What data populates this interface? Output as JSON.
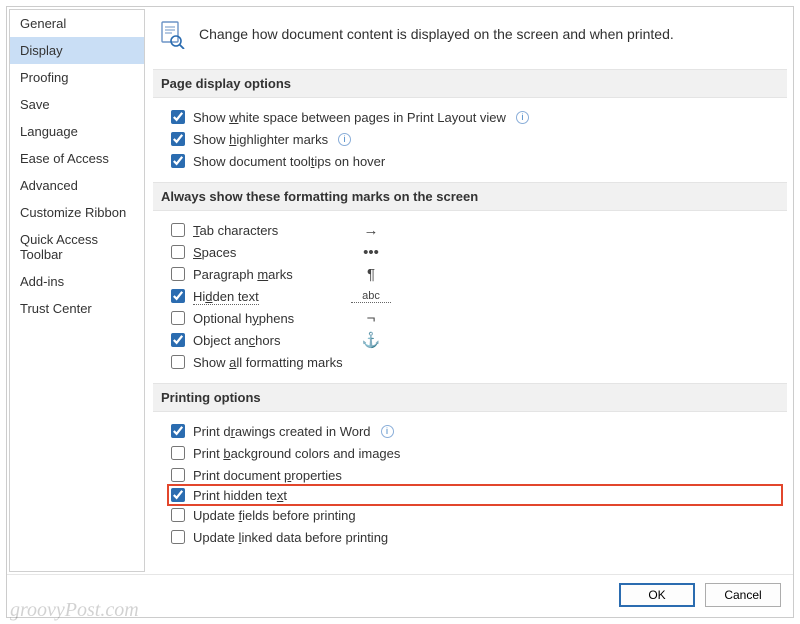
{
  "header": {
    "text": "Change how document content is displayed on the screen and when printed."
  },
  "sidebar": {
    "items": [
      {
        "label": "General",
        "selected": false,
        "name": "sidebar-item-general"
      },
      {
        "label": "Display",
        "selected": true,
        "name": "sidebar-item-display"
      },
      {
        "label": "Proofing",
        "selected": false,
        "name": "sidebar-item-proofing"
      },
      {
        "label": "Save",
        "selected": false,
        "name": "sidebar-item-save"
      },
      {
        "label": "Language",
        "selected": false,
        "name": "sidebar-item-language"
      },
      {
        "label": "Ease of Access",
        "selected": false,
        "name": "sidebar-item-ease-of-access"
      },
      {
        "label": "Advanced",
        "selected": false,
        "name": "sidebar-item-advanced"
      },
      {
        "label": "Customize Ribbon",
        "selected": false,
        "name": "sidebar-item-customize-ribbon"
      },
      {
        "label": "Quick Access Toolbar",
        "selected": false,
        "name": "sidebar-item-quick-access-toolbar"
      },
      {
        "label": "Add-ins",
        "selected": false,
        "name": "sidebar-item-add-ins"
      },
      {
        "label": "Trust Center",
        "selected": false,
        "name": "sidebar-item-trust-center"
      }
    ]
  },
  "sections": {
    "page_display": {
      "title": "Page display options",
      "items": [
        {
          "label_pre": "Show ",
          "accel": "w",
          "label_post": "hite space between pages in Print Layout view",
          "checked": true,
          "info": true,
          "name": "opt-white-space"
        },
        {
          "label_pre": "Show ",
          "accel": "h",
          "label_post": "ighlighter marks",
          "checked": true,
          "info": true,
          "name": "opt-highlighter"
        },
        {
          "label_pre": "Show document tool",
          "accel": "t",
          "label_post": "ips on hover",
          "checked": true,
          "info": false,
          "name": "opt-tooltips"
        }
      ]
    },
    "formatting_marks": {
      "title": "Always show these formatting marks on the screen",
      "items": [
        {
          "accel": "T",
          "label_rest": "ab characters",
          "checked": false,
          "symbol": "→",
          "symclass": "",
          "name": "opt-tab-chars"
        },
        {
          "accel": "S",
          "label_rest": "paces",
          "checked": false,
          "symbol": "•••",
          "symclass": "",
          "name": "opt-spaces"
        },
        {
          "label_pre": "Paragraph ",
          "accel": "m",
          "label_post": "arks",
          "checked": false,
          "symbol": "¶",
          "symclass": "",
          "name": "opt-paragraph-marks"
        },
        {
          "label_pre": "Hi",
          "accel": "d",
          "label_post": "den text",
          "checked": true,
          "symbol": "abc",
          "symclass": "abc-symbol",
          "dotted": true,
          "name": "opt-hidden-text"
        },
        {
          "label_pre": "Optional h",
          "accel": "y",
          "label_post": "phens",
          "checked": false,
          "symbol": "¬",
          "symclass": "",
          "name": "opt-optional-hyphens"
        },
        {
          "label_pre": "Object an",
          "accel": "c",
          "label_post": "hors",
          "checked": true,
          "symbol": "⚓",
          "symclass": "anchor-symbol",
          "name": "opt-object-anchors"
        },
        {
          "label_pre": "Show ",
          "accel": "a",
          "label_post": "ll formatting marks",
          "checked": false,
          "symbol": "",
          "symclass": "",
          "name": "opt-show-all-marks"
        }
      ]
    },
    "printing": {
      "title": "Printing options",
      "items": [
        {
          "label_pre": "Print d",
          "accel": "r",
          "label_post": "awings created in Word",
          "checked": true,
          "info": true,
          "highlight": false,
          "name": "opt-print-drawings"
        },
        {
          "label_pre": "Print ",
          "accel": "b",
          "label_post": "ackground colors and images",
          "checked": false,
          "info": false,
          "highlight": false,
          "name": "opt-print-background"
        },
        {
          "label_pre": "Print document ",
          "accel": "p",
          "label_post": "roperties",
          "checked": false,
          "info": false,
          "highlight": false,
          "name": "opt-print-properties"
        },
        {
          "label_pre": "Print hidden te",
          "accel": "x",
          "label_post": "t",
          "checked": true,
          "info": false,
          "highlight": true,
          "name": "opt-print-hidden-text"
        },
        {
          "label_pre": "Update ",
          "accel": "f",
          "label_post": "ields before printing",
          "checked": false,
          "info": false,
          "highlight": false,
          "name": "opt-update-fields"
        },
        {
          "label_pre": "Update ",
          "accel": "l",
          "label_post": "inked data before printing",
          "checked": false,
          "info": false,
          "highlight": false,
          "name": "opt-update-linked"
        }
      ]
    }
  },
  "footer": {
    "ok": "OK",
    "cancel": "Cancel"
  },
  "watermark": "groovyPost.com"
}
